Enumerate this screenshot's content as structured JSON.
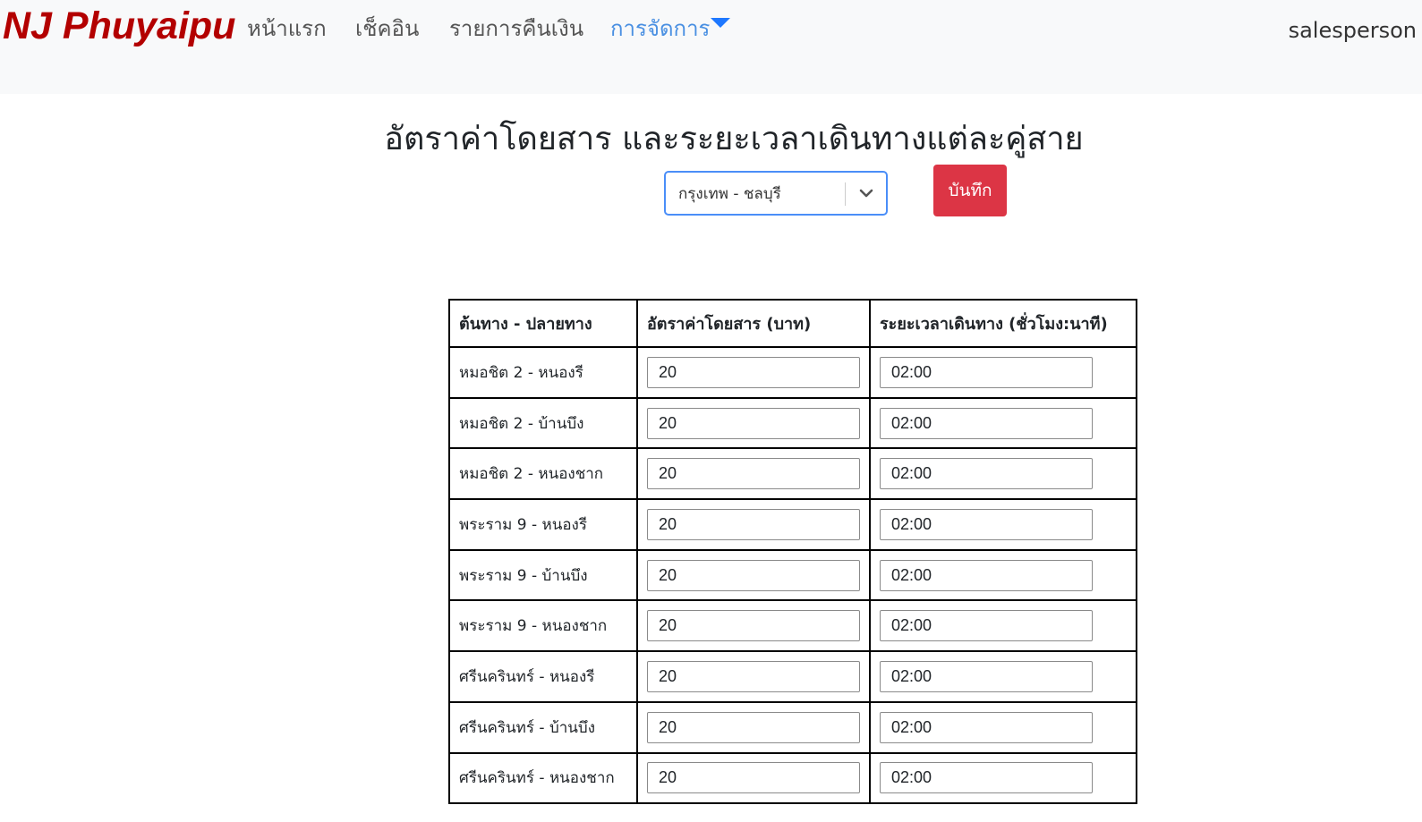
{
  "navbar": {
    "brand": "NJ Phuyaipu",
    "links": [
      "หน้าแรก",
      "เช็คอิน",
      "รายการคืนเงิน",
      "การจัดการ"
    ],
    "user": "salesperson"
  },
  "page": {
    "title": "อัตราค่าโดยสาร และระยะเวลาเดินทางแต่ละคู่สาย",
    "selected_route": "กรุงเทพ - ชลบุรี",
    "save_label": "บันทึก"
  },
  "colors": {
    "brand": "#b30000",
    "active_link": "#4a90e2",
    "save_button": "#dc3545",
    "select_border": "#4a8ef8"
  },
  "table": {
    "headers": [
      "ต้นทาง - ปลายทาง",
      "อัตราค่าโดยสาร (บาท)",
      "ระยะเวลาเดินทาง (ชั่วโมง:นาที)"
    ],
    "rows": [
      {
        "route": "หมอชิต 2 - หนองรี",
        "fare": "20",
        "duration": "02:00"
      },
      {
        "route": "หมอชิต 2 - บ้านบึง",
        "fare": "20",
        "duration": "02:00"
      },
      {
        "route": "หมอชิต 2 - หนองชาก",
        "fare": "20",
        "duration": "02:00"
      },
      {
        "route": "พระราม 9 - หนองรี",
        "fare": "20",
        "duration": "02:00"
      },
      {
        "route": "พระราม 9 - บ้านบึง",
        "fare": "20",
        "duration": "02:00"
      },
      {
        "route": "พระราม 9 - หนองชาก",
        "fare": "20",
        "duration": "02:00"
      },
      {
        "route": "ศรีนครินทร์ - หนองรี",
        "fare": "20",
        "duration": "02:00"
      },
      {
        "route": "ศรีนครินทร์ - บ้านบึง",
        "fare": "20",
        "duration": "02:00"
      },
      {
        "route": "ศรีนครินทร์ - หนองชาก",
        "fare": "20",
        "duration": "02:00"
      }
    ]
  }
}
